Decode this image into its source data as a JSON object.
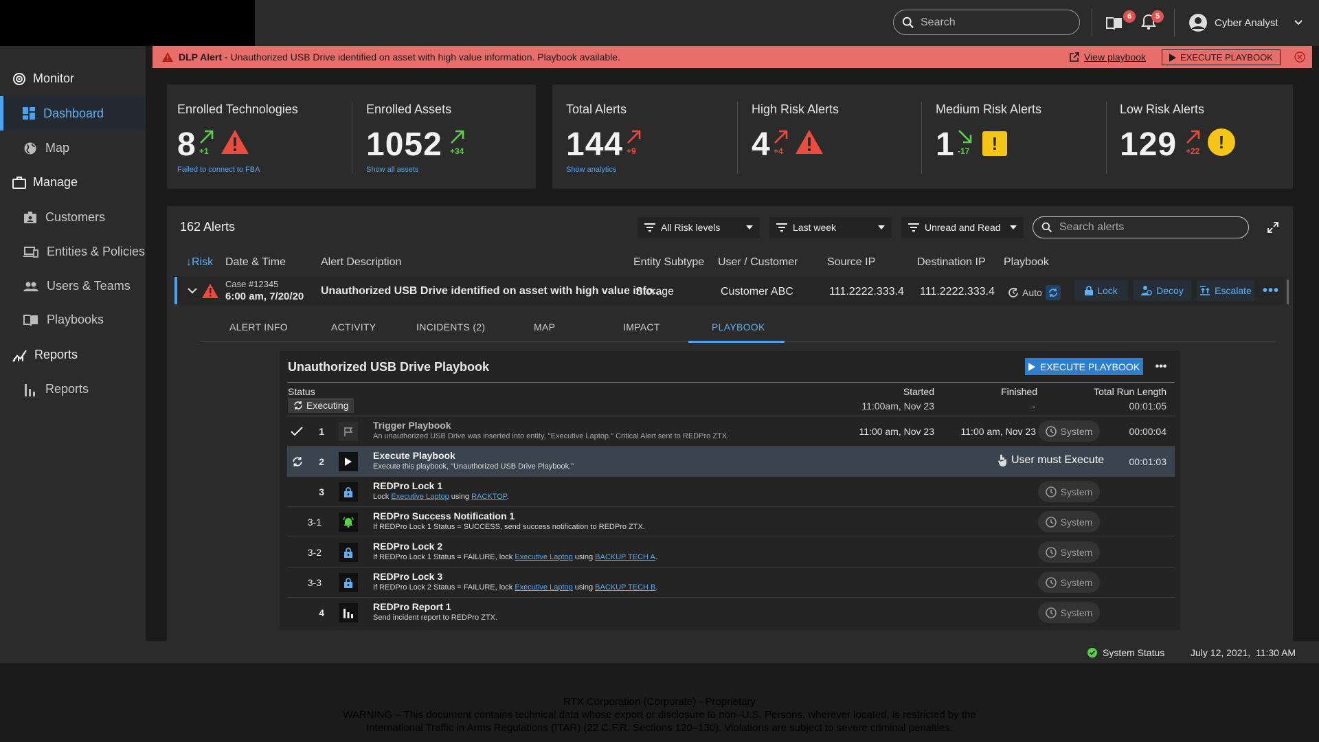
{
  "topbar": {
    "search_placeholder": "Search",
    "messages_count": "6",
    "notifications_count": "5",
    "user_name": "Cyber Analyst"
  },
  "sidebar": {
    "monitor": "Monitor",
    "dashboard": "Dashboard",
    "map": "Map",
    "manage": "Manage",
    "customers": "Customers",
    "entities": "Entities & Policies",
    "users": "Users & Teams",
    "playbooks": "Playbooks",
    "reports_section": "Reports",
    "reports": "Reports"
  },
  "banner": {
    "label": "DLP Alert - ",
    "message": "Unauthorized USB Drive identified on asset with high value information. Playbook available.",
    "view_link": "View playbook",
    "execute": "EXECUTE PLAYBOOK"
  },
  "kpis": {
    "enrolled_tech": {
      "title": "Enrolled Technologies",
      "value": "8",
      "delta": "+1",
      "link": "Failed to connect to FBA"
    },
    "enrolled_assets": {
      "title": "Enrolled Assets",
      "value": "1052",
      "delta": "+34",
      "link": "Show all assets"
    },
    "total_alerts": {
      "title": "Total Alerts",
      "value": "144",
      "delta": "+9",
      "link": "Show analytics"
    },
    "high_risk": {
      "title": "High Risk Alerts",
      "value": "4",
      "delta": "+4"
    },
    "medium_risk": {
      "title": "Medium Risk Alerts",
      "value": "1",
      "delta": "-17"
    },
    "low_risk": {
      "title": "Low Risk Alerts",
      "value": "129",
      "delta": "+22"
    }
  },
  "alerts": {
    "count_label": "162 Alerts",
    "filters": [
      "All Risk levels",
      "Last week",
      "Unread and Read"
    ],
    "search_placeholder": "Search alerts",
    "headers": {
      "risk": "Risk",
      "date": "Date & Time",
      "desc": "Alert Description",
      "subtype": "Entity Subtype",
      "user": "User / Customer",
      "src": "Source IP",
      "dst": "Destination IP",
      "playbook": "Playbook"
    },
    "row": {
      "case": "Case #12345",
      "datetime": "6:00 am, 7/20/20",
      "desc": "Unauthorized USB Drive identified on asset with high value info...",
      "subtype": "Storage",
      "user": "Customer ABC",
      "src": "111.2222.333.4",
      "dst": "111.2222.333.4",
      "mode": "Auto",
      "lock": "Lock",
      "decoy": "Decoy",
      "escalate": "Escalate"
    },
    "tabs": [
      "ALERT INFO",
      "ACTIVITY",
      "INCIDENTS (2)",
      "MAP",
      "IMPACT",
      "PLAYBOOK"
    ]
  },
  "playbook": {
    "title": "Unauthorized USB Drive Playbook",
    "execute": "EXECUTE PLAYBOOK",
    "status_label": "Status",
    "status_value": "Executing",
    "started_label": "Started",
    "started_value": "11:00am, Nov 23",
    "finished_label": "Finished",
    "finished_value": "-",
    "runlen_label": "Total Run Length",
    "runlen_value": "00:01:05",
    "steps": [
      {
        "num": "1",
        "title": "Trigger Playbook",
        "desc": "An unauthorized USB Drive was inserted into entity, \"Executive Laptop.\"  Critical Alert sent to REDPro ZTX.",
        "started": "11:00 am, Nov 23",
        "finished": "11:00 am, Nov 23",
        "actor": "System",
        "length": "00:00:04"
      },
      {
        "num": "2",
        "title": "Execute Playbook",
        "desc": "Execute this playbook, \"Unauthorized USB Drive Playbook.\"",
        "actor": "User must Execute",
        "length": "00:01:03"
      },
      {
        "num": "3",
        "title": "REDPro Lock 1",
        "desc_pre": "Lock ",
        "link1": "Executive Laptop",
        "desc_mid": " using ",
        "link2": "RACKTOP",
        "desc_post": ".",
        "actor": "System"
      },
      {
        "num": "3-1",
        "title": "REDPro Success Notification 1",
        "desc": "If REDPro Lock 1 Status = SUCCESS, send success notification to REDPro ZTX.",
        "actor": "System"
      },
      {
        "num": "3-2",
        "title": "REDPro Lock 2",
        "desc_pre": "If REDPro Lock 1 Status = FAILURE, lock ",
        "link1": "Executive Laptop",
        "desc_mid": " using ",
        "link2": "BACKUP TECH A",
        "desc_post": ".",
        "actor": "System"
      },
      {
        "num": "3-3",
        "title": "REDPro Lock 3",
        "desc_pre": "If REDPro Lock 2 Status = FAILURE, lock ",
        "link1": "Executive Laptop",
        "desc_mid": " using ",
        "link2": "BACKUP TECH B",
        "desc_post": ".",
        "actor": "System"
      },
      {
        "num": "4",
        "title": "REDPro Report 1",
        "desc": "Send incident report to REDPro ZTX.",
        "actor": "System"
      }
    ]
  },
  "statusbar": {
    "system_status": "System Status",
    "datetime": "July 12, 2021,  11:30 AM"
  },
  "footer": {
    "line1": "RTX Corporation (Corporate) - Proprietary",
    "line2": "WARNING – This document contains technical data whose export or disclosure to non–U.S. Persons, wherever located, is restricted by the",
    "line3": "International Traffic in Arms Regulations (ITAR) (22 C.F.R. Sections 120–130). Violations are subject to severe criminal penalties."
  },
  "colors": {
    "accent": "#4da3f0",
    "banner": "#e86e6b",
    "green": "#5bd14b",
    "red": "#ee4b3f",
    "warning_yellow": "#f5c518"
  }
}
